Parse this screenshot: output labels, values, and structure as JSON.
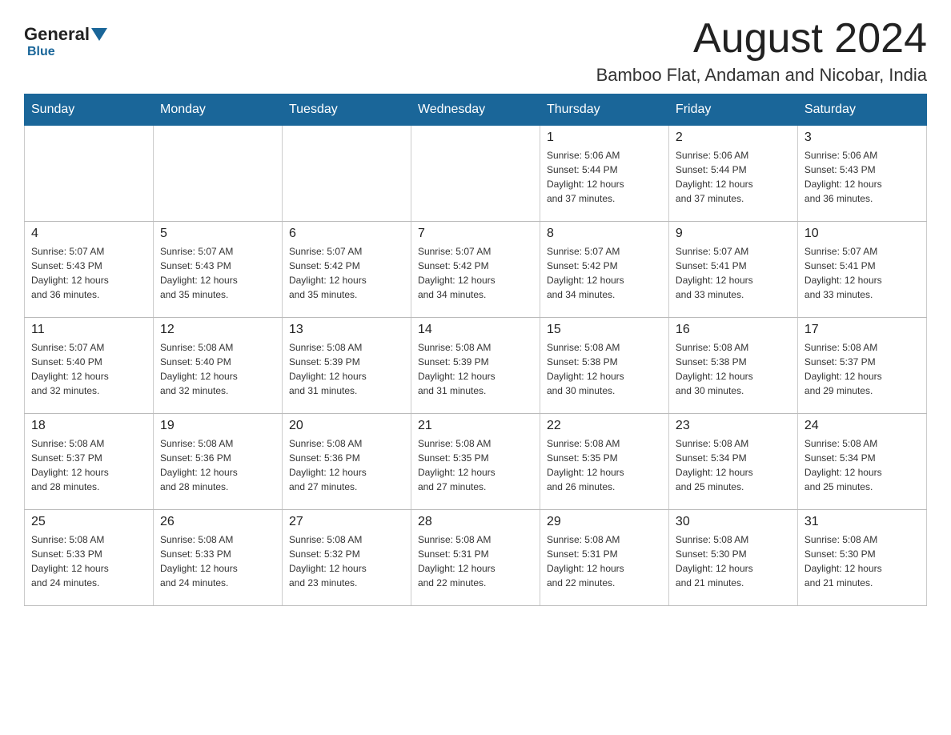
{
  "header": {
    "logo_general": "General",
    "logo_blue": "Blue",
    "title": "August 2024",
    "subtitle": "Bamboo Flat, Andaman and Nicobar, India"
  },
  "weekdays": [
    "Sunday",
    "Monday",
    "Tuesday",
    "Wednesday",
    "Thursday",
    "Friday",
    "Saturday"
  ],
  "weeks": [
    [
      {
        "day": "",
        "info": ""
      },
      {
        "day": "",
        "info": ""
      },
      {
        "day": "",
        "info": ""
      },
      {
        "day": "",
        "info": ""
      },
      {
        "day": "1",
        "info": "Sunrise: 5:06 AM\nSunset: 5:44 PM\nDaylight: 12 hours\nand 37 minutes."
      },
      {
        "day": "2",
        "info": "Sunrise: 5:06 AM\nSunset: 5:44 PM\nDaylight: 12 hours\nand 37 minutes."
      },
      {
        "day": "3",
        "info": "Sunrise: 5:06 AM\nSunset: 5:43 PM\nDaylight: 12 hours\nand 36 minutes."
      }
    ],
    [
      {
        "day": "4",
        "info": "Sunrise: 5:07 AM\nSunset: 5:43 PM\nDaylight: 12 hours\nand 36 minutes."
      },
      {
        "day": "5",
        "info": "Sunrise: 5:07 AM\nSunset: 5:43 PM\nDaylight: 12 hours\nand 35 minutes."
      },
      {
        "day": "6",
        "info": "Sunrise: 5:07 AM\nSunset: 5:42 PM\nDaylight: 12 hours\nand 35 minutes."
      },
      {
        "day": "7",
        "info": "Sunrise: 5:07 AM\nSunset: 5:42 PM\nDaylight: 12 hours\nand 34 minutes."
      },
      {
        "day": "8",
        "info": "Sunrise: 5:07 AM\nSunset: 5:42 PM\nDaylight: 12 hours\nand 34 minutes."
      },
      {
        "day": "9",
        "info": "Sunrise: 5:07 AM\nSunset: 5:41 PM\nDaylight: 12 hours\nand 33 minutes."
      },
      {
        "day": "10",
        "info": "Sunrise: 5:07 AM\nSunset: 5:41 PM\nDaylight: 12 hours\nand 33 minutes."
      }
    ],
    [
      {
        "day": "11",
        "info": "Sunrise: 5:07 AM\nSunset: 5:40 PM\nDaylight: 12 hours\nand 32 minutes."
      },
      {
        "day": "12",
        "info": "Sunrise: 5:08 AM\nSunset: 5:40 PM\nDaylight: 12 hours\nand 32 minutes."
      },
      {
        "day": "13",
        "info": "Sunrise: 5:08 AM\nSunset: 5:39 PM\nDaylight: 12 hours\nand 31 minutes."
      },
      {
        "day": "14",
        "info": "Sunrise: 5:08 AM\nSunset: 5:39 PM\nDaylight: 12 hours\nand 31 minutes."
      },
      {
        "day": "15",
        "info": "Sunrise: 5:08 AM\nSunset: 5:38 PM\nDaylight: 12 hours\nand 30 minutes."
      },
      {
        "day": "16",
        "info": "Sunrise: 5:08 AM\nSunset: 5:38 PM\nDaylight: 12 hours\nand 30 minutes."
      },
      {
        "day": "17",
        "info": "Sunrise: 5:08 AM\nSunset: 5:37 PM\nDaylight: 12 hours\nand 29 minutes."
      }
    ],
    [
      {
        "day": "18",
        "info": "Sunrise: 5:08 AM\nSunset: 5:37 PM\nDaylight: 12 hours\nand 28 minutes."
      },
      {
        "day": "19",
        "info": "Sunrise: 5:08 AM\nSunset: 5:36 PM\nDaylight: 12 hours\nand 28 minutes."
      },
      {
        "day": "20",
        "info": "Sunrise: 5:08 AM\nSunset: 5:36 PM\nDaylight: 12 hours\nand 27 minutes."
      },
      {
        "day": "21",
        "info": "Sunrise: 5:08 AM\nSunset: 5:35 PM\nDaylight: 12 hours\nand 27 minutes."
      },
      {
        "day": "22",
        "info": "Sunrise: 5:08 AM\nSunset: 5:35 PM\nDaylight: 12 hours\nand 26 minutes."
      },
      {
        "day": "23",
        "info": "Sunrise: 5:08 AM\nSunset: 5:34 PM\nDaylight: 12 hours\nand 25 minutes."
      },
      {
        "day": "24",
        "info": "Sunrise: 5:08 AM\nSunset: 5:34 PM\nDaylight: 12 hours\nand 25 minutes."
      }
    ],
    [
      {
        "day": "25",
        "info": "Sunrise: 5:08 AM\nSunset: 5:33 PM\nDaylight: 12 hours\nand 24 minutes."
      },
      {
        "day": "26",
        "info": "Sunrise: 5:08 AM\nSunset: 5:33 PM\nDaylight: 12 hours\nand 24 minutes."
      },
      {
        "day": "27",
        "info": "Sunrise: 5:08 AM\nSunset: 5:32 PM\nDaylight: 12 hours\nand 23 minutes."
      },
      {
        "day": "28",
        "info": "Sunrise: 5:08 AM\nSunset: 5:31 PM\nDaylight: 12 hours\nand 22 minutes."
      },
      {
        "day": "29",
        "info": "Sunrise: 5:08 AM\nSunset: 5:31 PM\nDaylight: 12 hours\nand 22 minutes."
      },
      {
        "day": "30",
        "info": "Sunrise: 5:08 AM\nSunset: 5:30 PM\nDaylight: 12 hours\nand 21 minutes."
      },
      {
        "day": "31",
        "info": "Sunrise: 5:08 AM\nSunset: 5:30 PM\nDaylight: 12 hours\nand 21 minutes."
      }
    ]
  ]
}
